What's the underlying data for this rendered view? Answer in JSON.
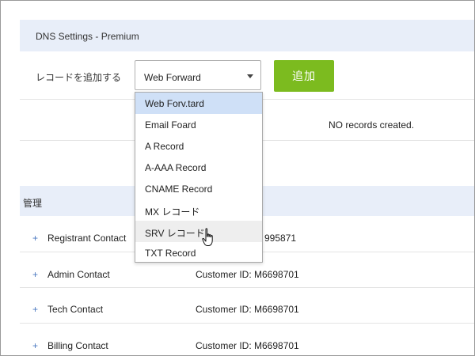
{
  "dns": {
    "title": "DNS Settings - Premium",
    "add_record_label": "レコードを追加する",
    "record_type_select": {
      "selected": "Web Forward"
    },
    "add_button_label": "追加",
    "no_records_text": "NO records created."
  },
  "dropdown": {
    "options": [
      "Web Forv.tard",
      "Email Foard",
      "A Record",
      "A-AAA Record",
      "CNAME Record",
      "MX レコード",
      "SRV レコード",
      "TXT Record"
    ],
    "highlighted_index": 0,
    "hover_index": 6
  },
  "management": {
    "title": "管理",
    "contacts": [
      {
        "name": "Registrant Contact",
        "id": "995871"
      },
      {
        "name": "Admin Contact",
        "id": "Customer ID: M6698701"
      },
      {
        "name": "Tech Contact",
        "id": "Customer ID: M6698701"
      },
      {
        "name": "Billing Contact",
        "id": "Customer ID: M6698701"
      }
    ],
    "expand_symbol": "+"
  },
  "colors": {
    "header_bg": "#e8eef9",
    "add_button": "#7cbb1f",
    "selected_option": "#cfe0f7",
    "plus_icon": "#4a78c0"
  },
  "icons": {
    "select_caret": "chevron-down-icon",
    "cursor": "hand-pointer-icon"
  }
}
